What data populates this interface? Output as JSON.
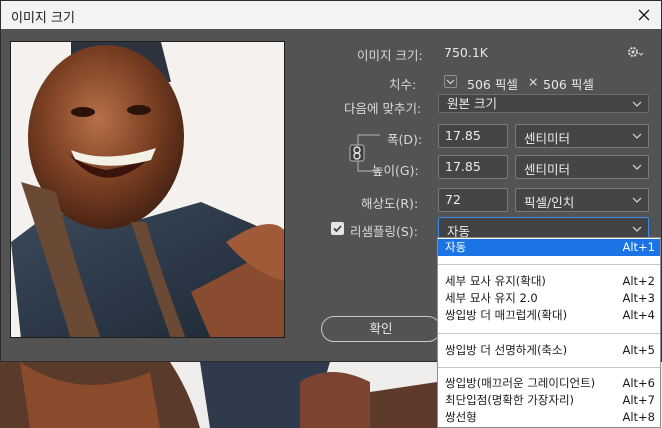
{
  "title": "이미지 크기",
  "image_size": {
    "label": "이미지 크기:",
    "value": "750.1K"
  },
  "dimensions": {
    "label": "치수:",
    "width": "506 픽셀",
    "times": "×",
    "height": "506 픽셀"
  },
  "fit_to": {
    "label": "다음에 맞추기:",
    "value": "원본 크기"
  },
  "width": {
    "label": "폭(D):",
    "value": "17.85",
    "unit": "센티미터"
  },
  "height": {
    "label": "높이(G):",
    "value": "17.85",
    "unit": "센티미터"
  },
  "resolution": {
    "label": "해상도(R):",
    "value": "72",
    "unit": "픽셀/인치"
  },
  "resample": {
    "label": "리샘플링(S):",
    "value": "자동",
    "checked": true
  },
  "ok_label": "확인",
  "resample_menu": [
    {
      "label": "자동",
      "shortcut": "Alt+1",
      "selected": true
    },
    {
      "label": "세부 묘사 유지(확대)",
      "shortcut": "Alt+2"
    },
    {
      "label": "세부 묘사 유지 2.0",
      "shortcut": "Alt+3"
    },
    {
      "label": "쌍입방 더 매끄럽게(확대)",
      "shortcut": "Alt+4"
    },
    {
      "label": "쌍입방 더 선명하게(축소)",
      "shortcut": "Alt+5"
    },
    {
      "label": "쌍입방(매끄러운 그레이디언트)",
      "shortcut": "Alt+6"
    },
    {
      "label": "최단입점(명확한 가장자리)",
      "shortcut": "Alt+7"
    },
    {
      "label": "쌍선형",
      "shortcut": "Alt+8"
    }
  ],
  "colors": {
    "dialog_bg": "#535353",
    "accent": "#1a74e6",
    "field_bg": "#454545"
  },
  "icons": [
    "close-icon",
    "gear-icon",
    "chevron-down-icon",
    "checkmark-icon",
    "chain-link-icon"
  ]
}
